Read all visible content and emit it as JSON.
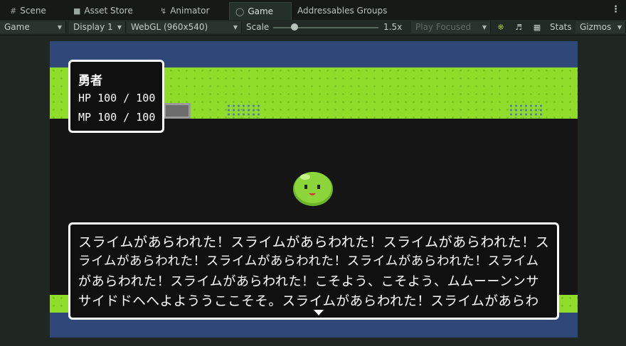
{
  "tabs": [
    {
      "label": "Scene",
      "icon": "grid-icon",
      "active": false
    },
    {
      "label": "Asset Store",
      "icon": "bag-icon",
      "active": false
    },
    {
      "label": "Animator",
      "icon": "animator-icon",
      "active": false
    },
    {
      "label": "Game",
      "icon": "gamepad-icon",
      "active": true
    },
    {
      "label": "Addressables Groups",
      "icon": "",
      "active": false
    }
  ],
  "toolbar": {
    "view_mode": "Game",
    "display": "Display 1",
    "resolution": "WebGL (960x540)",
    "scale_label": "Scale",
    "scale_value": "1.5x",
    "scale_fraction": 0.2,
    "play_mode": "Play Focused",
    "stats_label": "Stats",
    "gizmos_label": "Gizmos",
    "icons": [
      "bug-icon",
      "speaker-icon",
      "keyboard-icon"
    ]
  },
  "game": {
    "status": {
      "name": "勇者",
      "hp_label": "HP",
      "hp_value": "100 / 100",
      "mp_label": "MP",
      "mp_value": "100 / 100"
    },
    "message_lines": [
      "スライムがあらわれた！スライムがあらわれた！スライムがあらわれた！ス",
      "ライムがあらわれた！スライムがあらわれた！スライムがあらわれた！スライム",
      "があらわれた！スライムがあらわれた！こそよう、こそよう、ムムーーンンサ",
      "サイドドヘへよよううここそそ。スライムがあらわれた！スライムがあらわ"
    ],
    "colors": {
      "sky": "#2f4878",
      "grass": "#8fdc2a",
      "slime": "#8cd63c",
      "window_bg": "#101010",
      "window_border": "#ffffff"
    }
  }
}
